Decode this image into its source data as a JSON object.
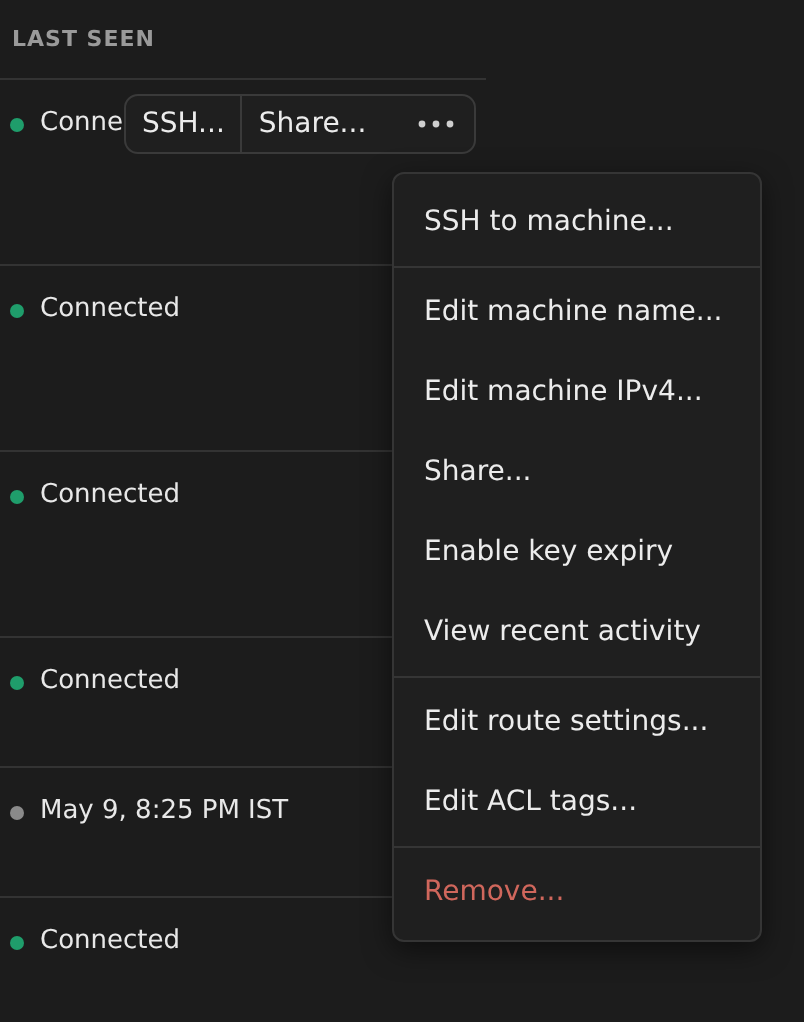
{
  "table": {
    "column_header": "LAST SEEN",
    "rows": [
      {
        "last_seen": "Conne",
        "color": "#1f9d6b"
      },
      {
        "last_seen": "Connected",
        "color": "#1f9d6b"
      },
      {
        "last_seen": "Connected",
        "color": "#1f9d6b"
      },
      {
        "last_seen": "Connected",
        "color": "#1f9d6b"
      },
      {
        "last_seen": "May 9, 8:25 PM IST",
        "color": "#8a8a8a"
      },
      {
        "last_seen": "Connected",
        "color": "#1f9d6b"
      }
    ]
  },
  "row_toolbar": {
    "buttons": [
      "SSH...",
      "Share..."
    ]
  },
  "menu": {
    "groups": [
      {
        "items": [
          {
            "label": "SSH to machine...",
            "kind": "normal"
          }
        ]
      },
      {
        "items": [
          {
            "label": "Edit machine name...",
            "kind": "normal"
          },
          {
            "label": "Edit machine IPv4...",
            "kind": "normal"
          },
          {
            "label": "Share...",
            "kind": "normal"
          },
          {
            "label": "Enable key expiry",
            "kind": "normal"
          },
          {
            "label": "View recent activity",
            "kind": "normal"
          }
        ]
      },
      {
        "items": [
          {
            "label": "Edit route settings...",
            "kind": "normal"
          },
          {
            "label": "Edit ACL tags...",
            "kind": "normal"
          }
        ]
      },
      {
        "items": [
          {
            "label": "Remove...",
            "kind": "danger"
          }
        ]
      }
    ]
  }
}
